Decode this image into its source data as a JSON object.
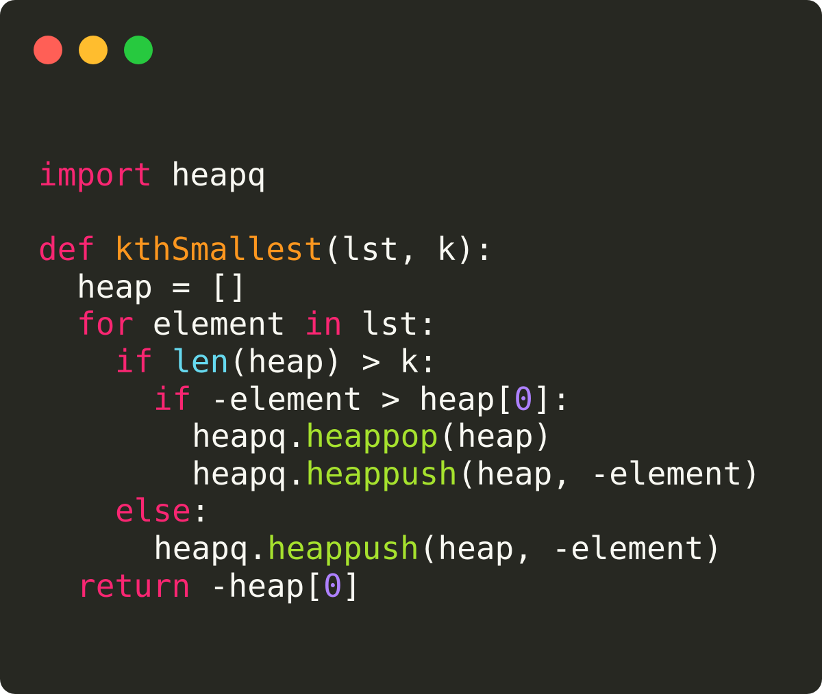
{
  "window": {
    "background": "#272822",
    "controls": [
      {
        "name": "close-button",
        "color": "#ff5f56"
      },
      {
        "name": "minimize-button",
        "color": "#ffbd2e"
      },
      {
        "name": "maximize-button",
        "color": "#27c93f"
      }
    ]
  },
  "colors": {
    "keyword": "#f92672",
    "function_def": "#fd971f",
    "builtin": "#66d9ef",
    "method": "#a6e22e",
    "number": "#ae81ff",
    "plain": "#f8f8f2"
  },
  "code": {
    "language": "python",
    "lines": [
      {
        "indent": 0,
        "tokens": [
          {
            "t": "import",
            "k": "keyword"
          },
          {
            "t": " heapq",
            "k": "plain"
          }
        ]
      },
      {
        "indent": 0,
        "tokens": []
      },
      {
        "indent": 0,
        "tokens": [
          {
            "t": "def",
            "k": "keyword"
          },
          {
            "t": " ",
            "k": "plain"
          },
          {
            "t": "kthSmallest",
            "k": "function_def"
          },
          {
            "t": "(lst, k):",
            "k": "plain"
          }
        ]
      },
      {
        "indent": 1,
        "tokens": [
          {
            "t": "heap = []",
            "k": "plain"
          }
        ]
      },
      {
        "indent": 1,
        "tokens": [
          {
            "t": "for",
            "k": "keyword"
          },
          {
            "t": " element ",
            "k": "plain"
          },
          {
            "t": "in",
            "k": "keyword"
          },
          {
            "t": " lst:",
            "k": "plain"
          }
        ]
      },
      {
        "indent": 2,
        "tokens": [
          {
            "t": "if",
            "k": "keyword"
          },
          {
            "t": " ",
            "k": "plain"
          },
          {
            "t": "len",
            "k": "builtin"
          },
          {
            "t": "(heap) > k:",
            "k": "plain"
          }
        ]
      },
      {
        "indent": 3,
        "tokens": [
          {
            "t": "if",
            "k": "keyword"
          },
          {
            "t": " -element > heap[",
            "k": "plain"
          },
          {
            "t": "0",
            "k": "number"
          },
          {
            "t": "]:",
            "k": "plain"
          }
        ]
      },
      {
        "indent": 4,
        "tokens": [
          {
            "t": "heapq.",
            "k": "plain"
          },
          {
            "t": "heappop",
            "k": "method"
          },
          {
            "t": "(heap)",
            "k": "plain"
          }
        ]
      },
      {
        "indent": 4,
        "tokens": [
          {
            "t": "heapq.",
            "k": "plain"
          },
          {
            "t": "heappush",
            "k": "method"
          },
          {
            "t": "(heap, -element)",
            "k": "plain"
          }
        ]
      },
      {
        "indent": 2,
        "tokens": [
          {
            "t": "else",
            "k": "keyword"
          },
          {
            "t": ":",
            "k": "plain"
          }
        ]
      },
      {
        "indent": 3,
        "tokens": [
          {
            "t": "heapq.",
            "k": "plain"
          },
          {
            "t": "heappush",
            "k": "method"
          },
          {
            "t": "(heap, -element)",
            "k": "plain"
          }
        ]
      },
      {
        "indent": 1,
        "tokens": [
          {
            "t": "return",
            "k": "keyword"
          },
          {
            "t": " -heap[",
            "k": "plain"
          },
          {
            "t": "0",
            "k": "number"
          },
          {
            "t": "]",
            "k": "plain"
          }
        ]
      }
    ]
  }
}
